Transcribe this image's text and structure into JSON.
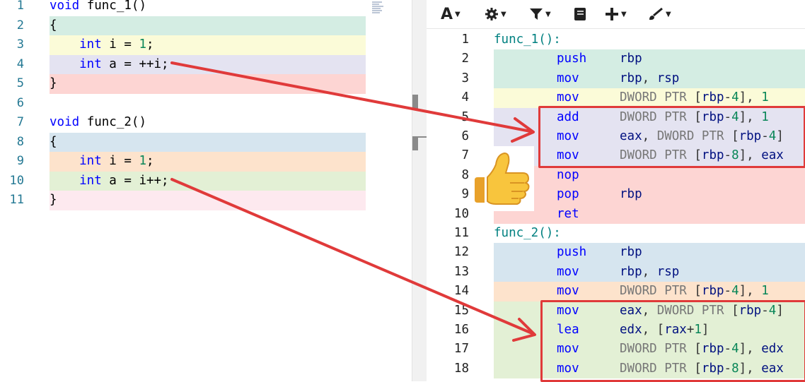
{
  "source": {
    "lines": [
      {
        "n": "1",
        "kw": "void",
        "rest": " func_1()",
        "num": "",
        "tail": ""
      },
      {
        "n": "2",
        "kw": "",
        "rest": "{",
        "num": "",
        "tail": ""
      },
      {
        "n": "3",
        "kw": "    int",
        "rest": " i = ",
        "num": "1",
        "tail": ";"
      },
      {
        "n": "4",
        "kw": "    int",
        "rest": " a = ++i;",
        "num": "",
        "tail": ""
      },
      {
        "n": "5",
        "kw": "",
        "rest": "}",
        "num": "",
        "tail": ""
      },
      {
        "n": "6",
        "kw": "",
        "rest": "",
        "num": "",
        "tail": ""
      },
      {
        "n": "7",
        "kw": "void",
        "rest": " func_2()",
        "num": "",
        "tail": ""
      },
      {
        "n": "8",
        "kw": "",
        "rest": "{",
        "num": "",
        "tail": ""
      },
      {
        "n": "9",
        "kw": "    int",
        "rest": " i = ",
        "num": "1",
        "tail": ";"
      },
      {
        "n": "10",
        "kw": "    int",
        "rest": " a = i++;",
        "num": "",
        "tail": ""
      },
      {
        "n": "11",
        "kw": "",
        "rest": "}",
        "num": "",
        "tail": ""
      }
    ]
  },
  "asm": {
    "lines": [
      {
        "n": "1",
        "label": "func_1():",
        "op": "",
        "args": ""
      },
      {
        "n": "2",
        "label": "",
        "op": "push",
        "args": "rbp"
      },
      {
        "n": "3",
        "label": "",
        "op": "mov",
        "args": "rbp, rsp"
      },
      {
        "n": "4",
        "label": "",
        "op": "mov",
        "args": "DWORD PTR [rbp-4], 1"
      },
      {
        "n": "5",
        "label": "",
        "op": "add",
        "args": "DWORD PTR [rbp-4], 1"
      },
      {
        "n": "6",
        "label": "",
        "op": "mov",
        "args": "eax, DWORD PTR [rbp-4]"
      },
      {
        "n": "7",
        "label": "",
        "op": "mov",
        "args": "DWORD PTR [rbp-8], eax"
      },
      {
        "n": "8",
        "label": "",
        "op": "nop",
        "args": ""
      },
      {
        "n": "9",
        "label": "",
        "op": "pop",
        "args": "rbp"
      },
      {
        "n": "10",
        "label": "",
        "op": "ret",
        "args": ""
      },
      {
        "n": "11",
        "label": "func_2():",
        "op": "",
        "args": ""
      },
      {
        "n": "12",
        "label": "",
        "op": "push",
        "args": "rbp"
      },
      {
        "n": "13",
        "label": "",
        "op": "mov",
        "args": "rbp, rsp"
      },
      {
        "n": "14",
        "label": "",
        "op": "mov",
        "args": "DWORD PTR [rbp-4], 1"
      },
      {
        "n": "15",
        "label": "",
        "op": "mov",
        "args": "eax, DWORD PTR [rbp-4]"
      },
      {
        "n": "16",
        "label": "",
        "op": "lea",
        "args": "edx, [rax+1]"
      },
      {
        "n": "17",
        "label": "",
        "op": "mov",
        "args": "DWORD PTR [rbp-4], edx"
      },
      {
        "n": "18",
        "label": "",
        "op": "mov",
        "args": "DWORD PTR [rbp-8], eax"
      }
    ]
  },
  "toolbar": {
    "buttons": [
      {
        "name": "font-size-button",
        "icon": "font-a-icon",
        "label": "A"
      },
      {
        "name": "settings-button",
        "icon": "gear-icon",
        "label": ""
      },
      {
        "name": "filter-button",
        "icon": "filter-icon",
        "label": ""
      },
      {
        "name": "libraries-button",
        "icon": "book-icon",
        "label": ""
      },
      {
        "name": "add-tool-button",
        "icon": "plus-icon",
        "label": ""
      },
      {
        "name": "tools-button",
        "icon": "brush-icon",
        "label": ""
      }
    ]
  },
  "colors": {
    "green": "#d4ede3",
    "yellow": "#fbfbd8",
    "purple": "#e4e3f1",
    "red": "#fdd5d3",
    "blue": "#d6e5ef",
    "orange": "#fde3cc",
    "lime": "#e3f0d5",
    "pink": "#fde9ef",
    "accent_red": "#e03a3a"
  }
}
